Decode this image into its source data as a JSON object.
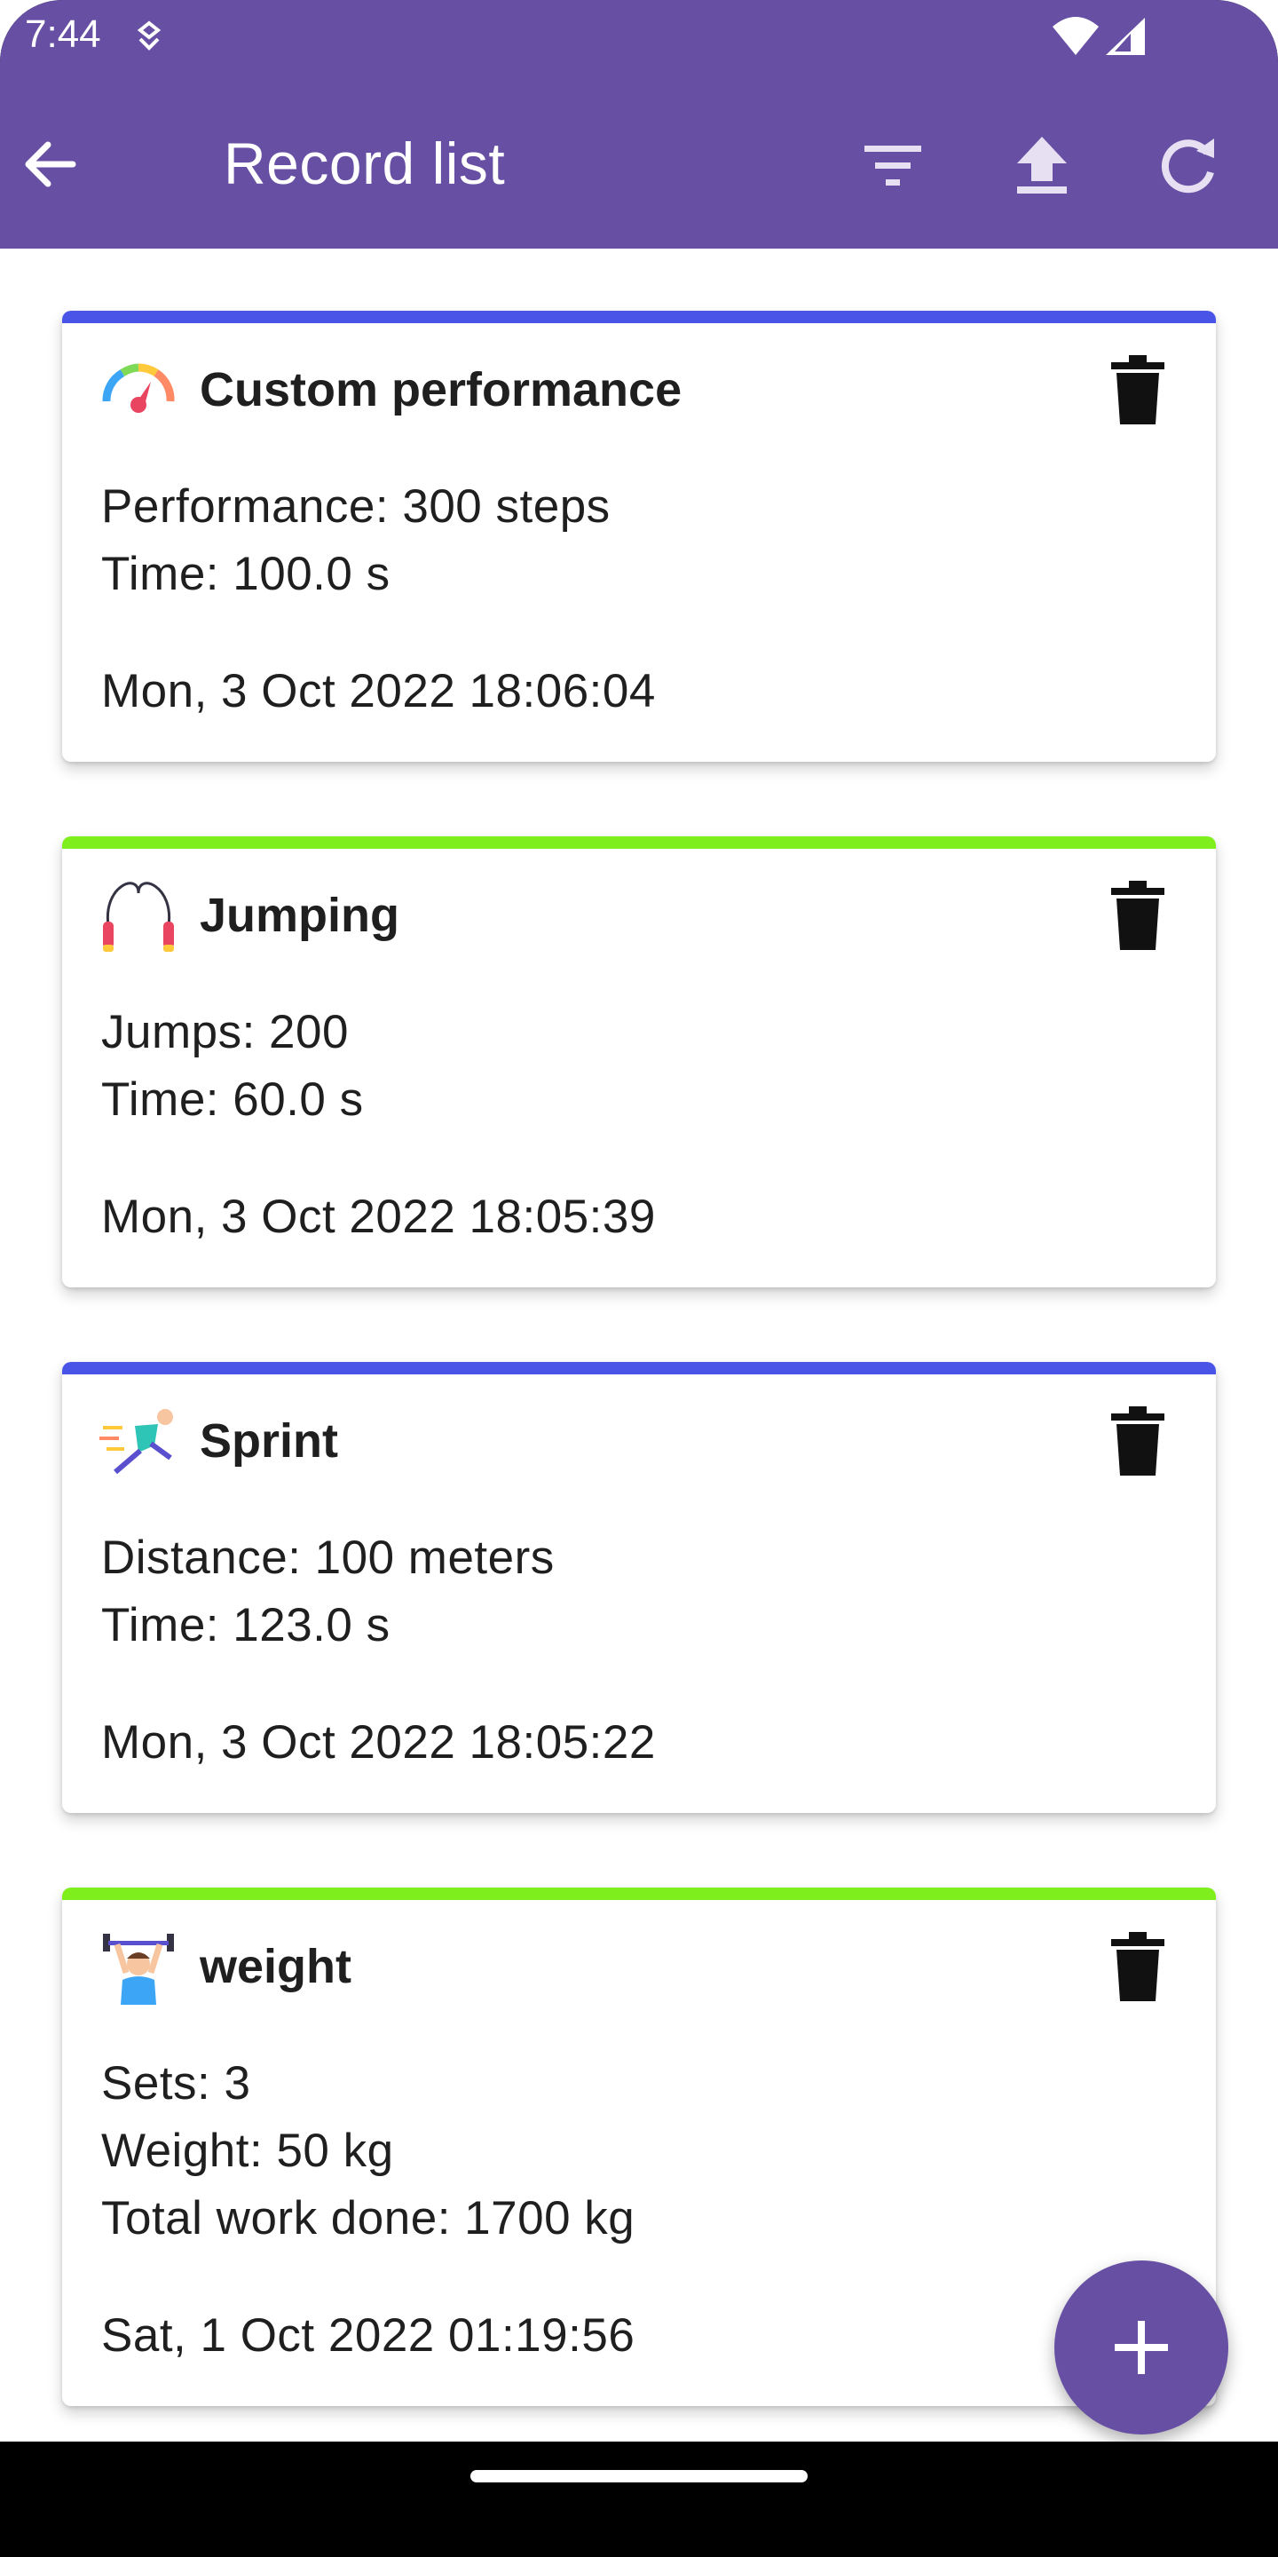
{
  "status_bar": {
    "time": "7:44"
  },
  "app_bar": {
    "title": "Record list",
    "actions": [
      "filter-icon",
      "upload-icon",
      "refresh-icon"
    ]
  },
  "colors": {
    "primary": "#6750A4",
    "blue_bar": "#4A55E8",
    "green_bar": "#7FEE1D"
  },
  "records": [
    {
      "title": "Custom performance",
      "icon": "speedometer-icon",
      "bar_color": "blue",
      "lines": [
        "Performance: 300 steps",
        "Time: 100.0 s"
      ],
      "date": "Mon, 3 Oct 2022 18:06:04"
    },
    {
      "title": "Jumping",
      "icon": "jump-rope-icon",
      "bar_color": "green",
      "lines": [
        "Jumps: 200",
        "Time: 60.0 s"
      ],
      "date": "Mon, 3 Oct 2022 18:05:39"
    },
    {
      "title": "Sprint",
      "icon": "sprinter-icon",
      "bar_color": "blue",
      "lines": [
        "Distance: 100 meters",
        "Time: 123.0 s"
      ],
      "date": "Mon, 3 Oct 2022 18:05:22"
    },
    {
      "title": "weight",
      "icon": "weightlifter-icon",
      "bar_color": "green",
      "lines": [
        "Sets: 3",
        "Weight: 50 kg",
        "Total work done: 1700 kg"
      ],
      "date": "Sat, 1 Oct 2022 01:19:56"
    }
  ],
  "fab": {
    "icon": "plus-icon"
  }
}
